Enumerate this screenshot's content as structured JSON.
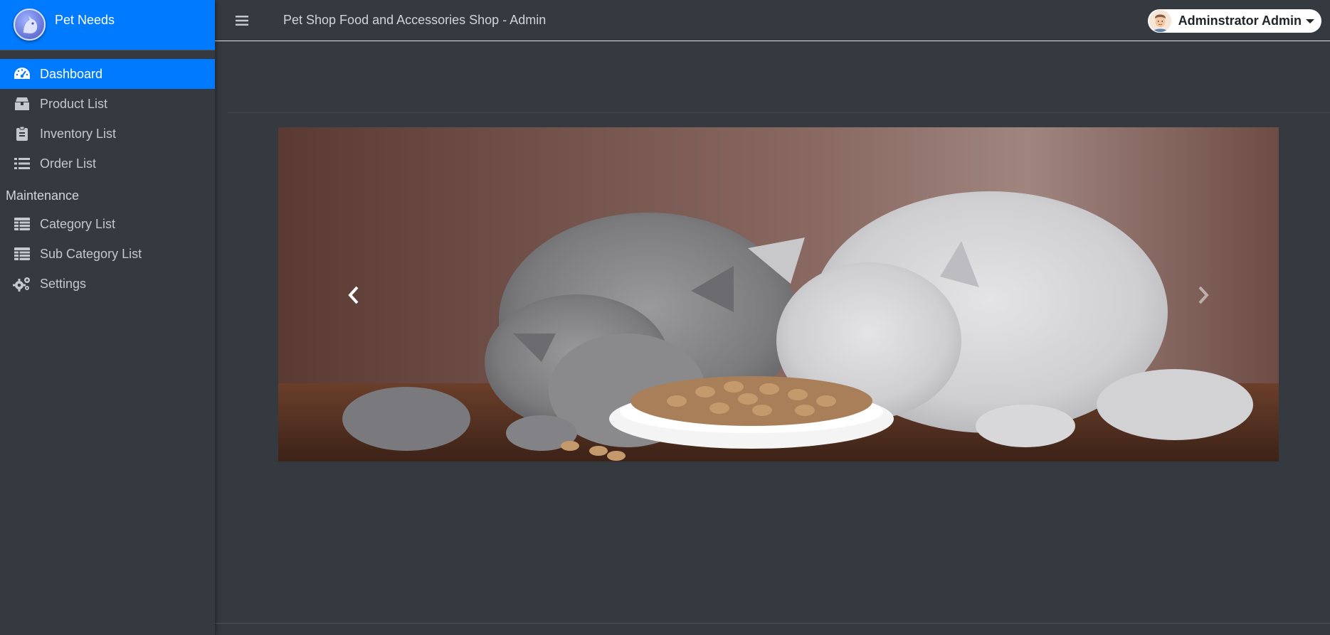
{
  "brand": {
    "name": "Pet Needs",
    "logo_icon": "cat-dog-logo-icon"
  },
  "topbar": {
    "title": "Pet Shop Food and Accessories Shop - Admin",
    "menu_icon": "hamburger-icon",
    "user": {
      "name": "Adminstrator Admin",
      "avatar": "avatar"
    }
  },
  "sidebar": {
    "items": [
      {
        "label": "Dashboard",
        "icon": "dashboard-icon",
        "active": true
      },
      {
        "label": "Product List",
        "icon": "box-icon"
      },
      {
        "label": "Inventory List",
        "icon": "clipboard-icon"
      },
      {
        "label": "Order List",
        "icon": "list-icon"
      }
    ],
    "maintenance_header": "Maintenance",
    "maintenance_items": [
      {
        "label": "Category List",
        "icon": "table-icon"
      },
      {
        "label": "Sub Category List",
        "icon": "table-icon"
      },
      {
        "label": "Settings",
        "icon": "gears-icon"
      }
    ]
  },
  "carousel": {
    "image": "kittens-eating-banner",
    "prev_icon": "chevron-left-icon",
    "next_icon": "chevron-right-icon"
  },
  "colors": {
    "primary": "#007bff",
    "background": "#343a40",
    "sidebar_text": "#c2c7d0"
  }
}
